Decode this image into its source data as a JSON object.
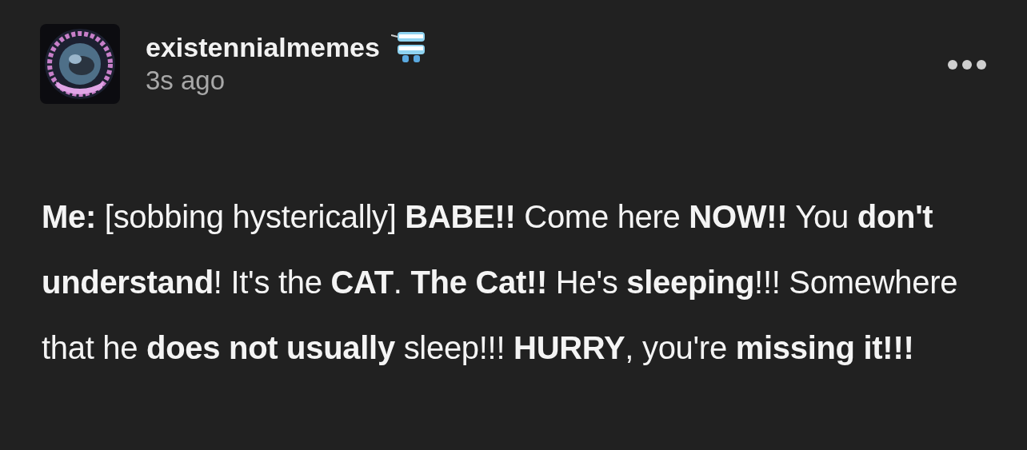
{
  "post": {
    "author": "existennialmemes",
    "time": "3s ago",
    "body": "**Me:** [sobbing hysterically] **BABE!!** Come here **NOW!!** You **don't understand**! It's the **CAT**. **The Cat!!** He's **sleeping**!!! Somewhere that he **does not usually** sleep!!! **HURRY**, you're **missing it!!!**"
  }
}
